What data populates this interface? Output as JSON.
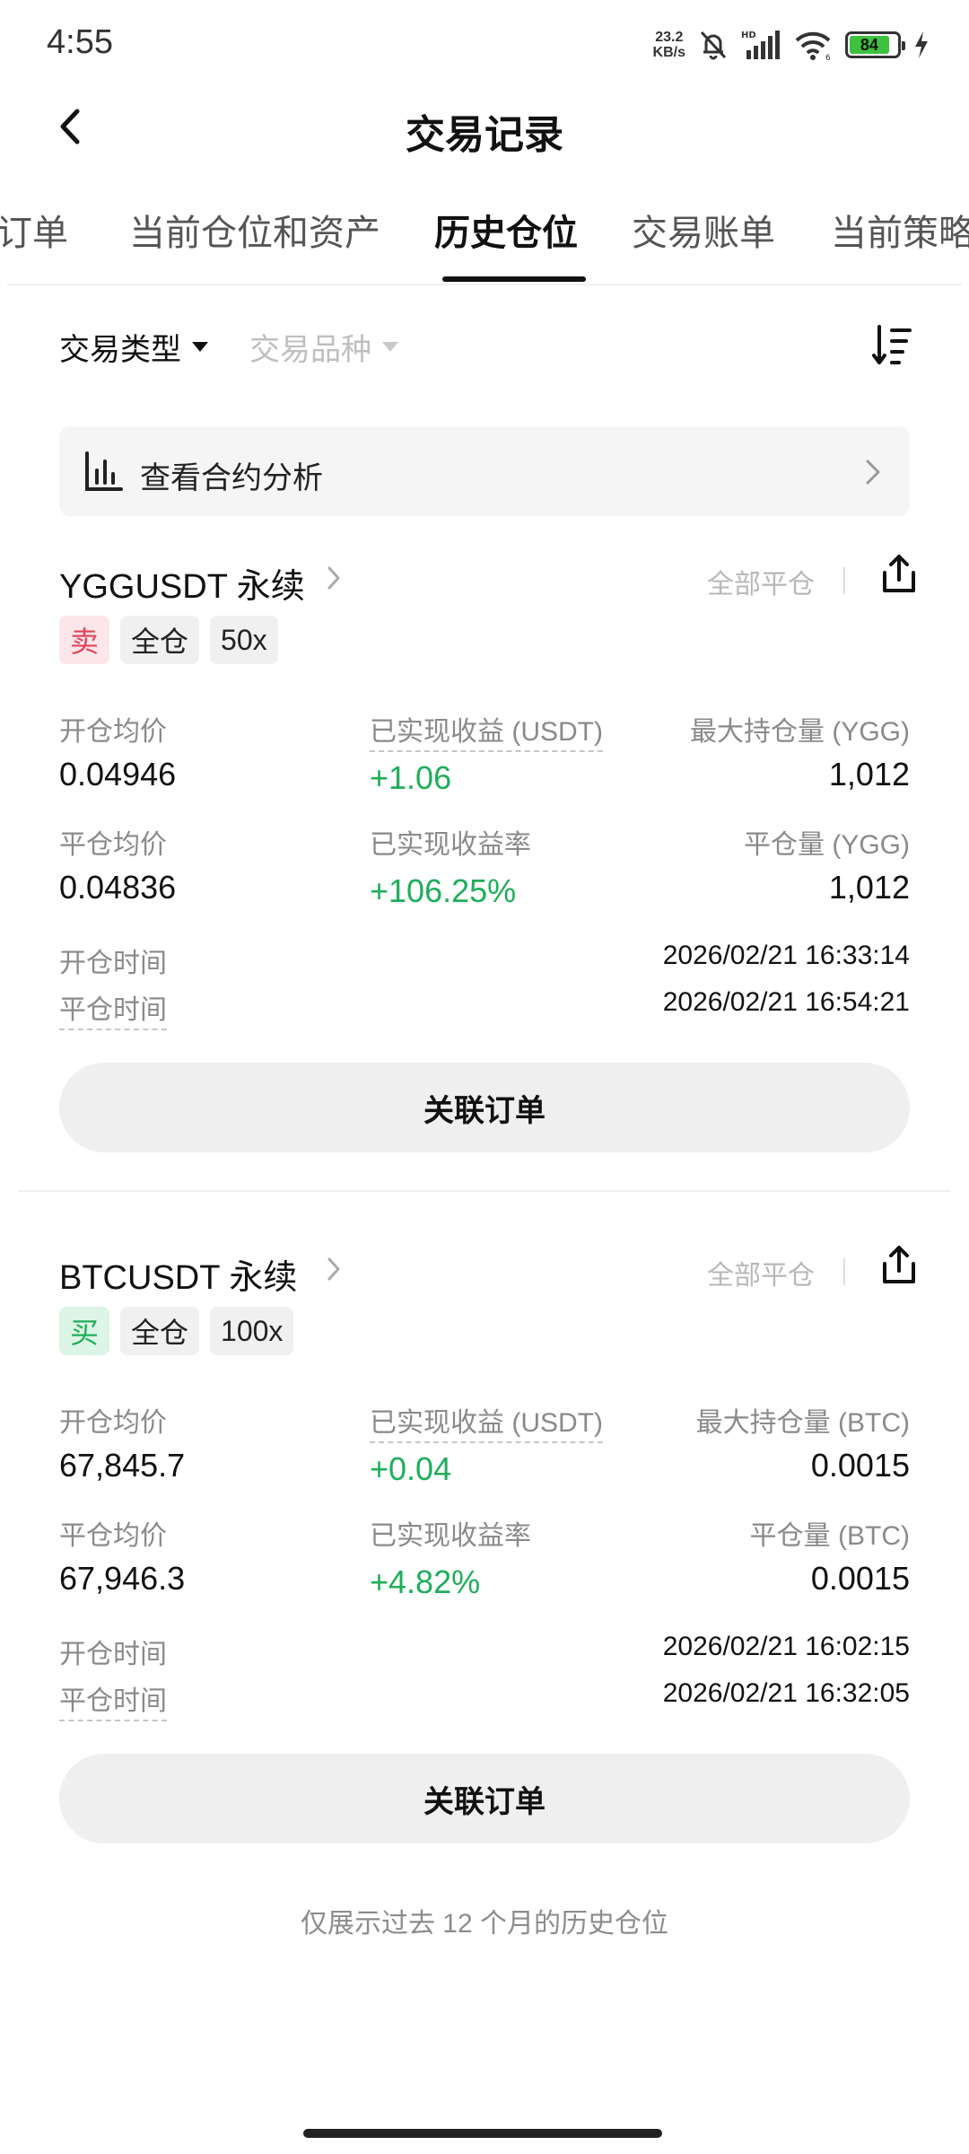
{
  "status_bar": {
    "time": "4:55",
    "net_speed_value": "23.2",
    "net_speed_unit": "KB/s",
    "battery": "84",
    "icons": [
      "mute-bell-icon",
      "hd-signal-icon",
      "wifi-icon",
      "battery-icon",
      "charging-icon"
    ]
  },
  "header": {
    "title": "交易记录"
  },
  "tabs": [
    {
      "label": "订单"
    },
    {
      "label": "当前仓位和资产"
    },
    {
      "label": "历史仓位",
      "active": true
    },
    {
      "label": "交易账单"
    },
    {
      "label": "当前策略"
    }
  ],
  "filters": {
    "trade_type": "交易类型",
    "trade_symbol": "交易品种"
  },
  "banner": {
    "label": "查看合约分析"
  },
  "positions": [
    {
      "symbol": "YGGUSDT 永续",
      "close_all": "全部平仓",
      "side": "卖",
      "margin_mode": "全仓",
      "leverage": "50x",
      "open_avg_label": "开仓均价",
      "open_avg": "0.04946",
      "realized_pnl_label": "已实现收益 (USDT)",
      "realized_pnl": "+1.06",
      "max_hold_label": "最大持仓量 (YGG)",
      "max_hold": "1,012",
      "close_avg_label": "平仓均价",
      "close_avg": "0.04836",
      "realized_rate_label": "已实现收益率",
      "realized_rate": "+106.25%",
      "close_qty_label": "平仓量 (YGG)",
      "close_qty": "1,012",
      "open_time_label": "开仓时间",
      "open_time": "2026/02/21 16:33:14",
      "close_time_label": "平仓时间",
      "close_time": "2026/02/21 16:54:21",
      "orders_button": "关联订单"
    },
    {
      "symbol": "BTCUSDT 永续",
      "close_all": "全部平仓",
      "side": "买",
      "margin_mode": "全仓",
      "leverage": "100x",
      "open_avg_label": "开仓均价",
      "open_avg": "67,845.7",
      "realized_pnl_label": "已实现收益 (USDT)",
      "realized_pnl": "+0.04",
      "max_hold_label": "最大持仓量 (BTC)",
      "max_hold": "0.0015",
      "close_avg_label": "平仓均价",
      "close_avg": "67,946.3",
      "realized_rate_label": "已实现收益率",
      "realized_rate": "+4.82%",
      "close_qty_label": "平仓量 (BTC)",
      "close_qty": "0.0015",
      "open_time_label": "开仓时间",
      "open_time": "2026/02/21 16:02:15",
      "close_time_label": "平仓时间",
      "close_time": "2026/02/21 16:32:05",
      "orders_button": "关联订单"
    }
  ],
  "footer_note": "仅展示过去 12 个月的历史仓位",
  "colors": {
    "profit_green": "#1fae5a",
    "sell_red": "#e0435d",
    "text_primary": "#111111",
    "text_secondary": "#8a8a8a"
  }
}
